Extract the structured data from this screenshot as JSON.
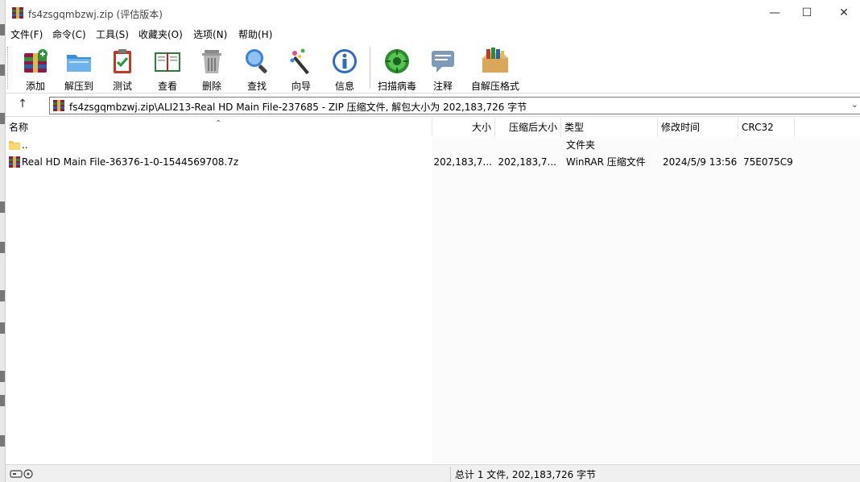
{
  "window": {
    "title": "fs4zsgqmbzwj.zip (评估版本)",
    "controls": {
      "minimize": "—",
      "maximize": "☐",
      "close": "✕"
    }
  },
  "menu": [
    {
      "label": "文件(F)"
    },
    {
      "label": "命令(C)"
    },
    {
      "label": "工具(S)"
    },
    {
      "label": "收藏夹(O)"
    },
    {
      "label": "选项(N)"
    },
    {
      "label": "帮助(H)"
    }
  ],
  "toolbar": [
    {
      "label": "添加",
      "icon": "add-archive-icon"
    },
    {
      "label": "解压到",
      "icon": "extract-folder-icon"
    },
    {
      "label": "测试",
      "icon": "test-clipboard-icon"
    },
    {
      "label": "查看",
      "icon": "view-book-icon"
    },
    {
      "label": "删除",
      "icon": "trash-can-icon"
    },
    {
      "label": "查找",
      "icon": "magnifier-icon"
    },
    {
      "label": "向导",
      "icon": "magic-wand-icon"
    },
    {
      "label": "信息",
      "icon": "info-icon"
    },
    {
      "label": "扫描病毒",
      "icon": "virus-scan-icon"
    },
    {
      "label": "注释",
      "icon": "comment-icon"
    },
    {
      "label": "自解压格式",
      "icon": "sfx-box-icon"
    }
  ],
  "address": {
    "up": "↑",
    "path": "fs4zsgqmbzwj.zip\\ALI213-Real HD Main File-237685 - ZIP 压缩文件, 解包大小为 202,183,726 字节",
    "dropdown": "⌄"
  },
  "columns": {
    "name": "名称",
    "size": "大小",
    "packed": "压缩后大小",
    "type": "类型",
    "modified": "修改时间",
    "crc": "CRC32"
  },
  "rows": [
    {
      "name": "..",
      "size": "",
      "packed": "",
      "type": "文件夹",
      "modified": "",
      "crc": "",
      "icon": "folder-icon"
    },
    {
      "name": "Real HD Main File-36376-1-0-1544569708.7z",
      "size": "202,183,7...",
      "packed": "202,183,7...",
      "type": "WinRAR 压缩文件",
      "modified": "2024/5/9 13:56",
      "crc": "75E075C9",
      "icon": "rar-archive-icon"
    }
  ],
  "status": {
    "summary": "总计 1 文件, 202,183,726 字节"
  },
  "colors": {
    "accent": "#1e6fd9",
    "folder": "#f3c74a"
  }
}
